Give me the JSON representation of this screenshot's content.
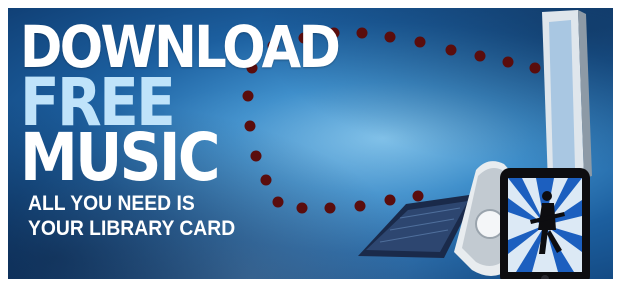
{
  "banner": {
    "headline": {
      "line1": "DOWNLOAD",
      "line2": "FREE",
      "line3": "MUSIC"
    },
    "subheadline": {
      "line1": "ALL YOU NEED IS",
      "line2": "YOUR LIBRARY CARD"
    }
  },
  "colors": {
    "background_blue": "#1c5f9f",
    "highlight_blue": "#7fc0e8",
    "free_text": "#bfe3fa",
    "dot_color": "#5a0d0d"
  },
  "icons": [
    "computer-monitor",
    "keyboard",
    "mp3-player",
    "smartphone",
    "guitarist-silhouette"
  ]
}
